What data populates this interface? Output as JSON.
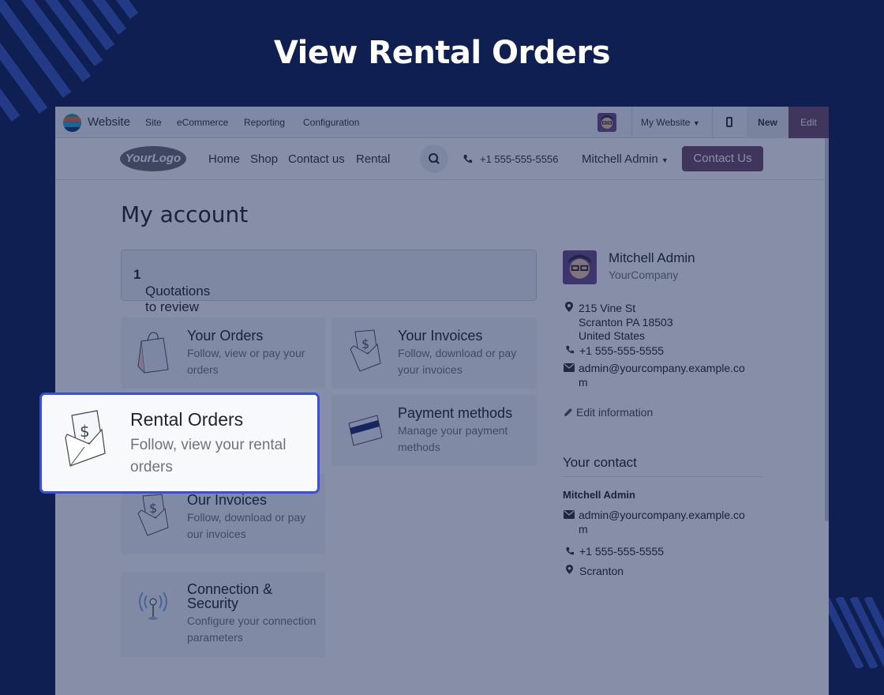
{
  "hero": {
    "title": "View Rental Orders"
  },
  "topbar": {
    "app_name": "Website",
    "menu": [
      "Site",
      "eCommerce",
      "Reporting",
      "Configuration"
    ],
    "website_selector": "My Website",
    "new_label": "New",
    "edit_label": "Edit"
  },
  "site_nav": {
    "logo_text": "YourLogo",
    "links": [
      "Home",
      "Shop",
      "Contact us",
      "Rental"
    ],
    "phone": "+1 555-555-5556",
    "user": "Mitchell Admin",
    "contact_button": "Contact Us"
  },
  "page": {
    "title": "My account",
    "quotations_count": "1",
    "quotations_label": "Quotations to review",
    "cards": {
      "your_orders": {
        "title": "Your Orders",
        "desc": "Follow, view or pay your orders"
      },
      "your_invoices": {
        "title": "Your Invoices",
        "desc": "Follow, download or pay your invoices"
      },
      "payment_methods": {
        "title": "Payment methods",
        "desc": "Manage your payment methods"
      },
      "our_invoices": {
        "title": "Our Invoices",
        "desc": "Follow, download or pay our invoices"
      },
      "connection_security": {
        "title": "Connection & Security",
        "desc": "Configure your connection parameters"
      }
    },
    "highlighted": {
      "title": "Rental Orders",
      "desc": "Follow, view your rental orders"
    }
  },
  "sidebar": {
    "name": "Mitchell Admin",
    "company": "YourCompany",
    "address": [
      "215 Vine St",
      "Scranton PA 18503",
      "United States"
    ],
    "phone": "+1 555-555-5555",
    "email_line1": "admin@yourcompany.example.co",
    "email_line2": "m",
    "edit_info": "Edit information",
    "contact_heading": "Your contact",
    "contact_name": "Mitchell Admin",
    "contact_email_line1": "admin@yourcompany.example.co",
    "contact_email_line2": "m",
    "contact_phone": "+1 555-555-5555",
    "contact_city": "Scranton"
  },
  "colors": {
    "background": "#101f52",
    "brand": "#714b67",
    "highlight_border": "#3a4fd8"
  }
}
